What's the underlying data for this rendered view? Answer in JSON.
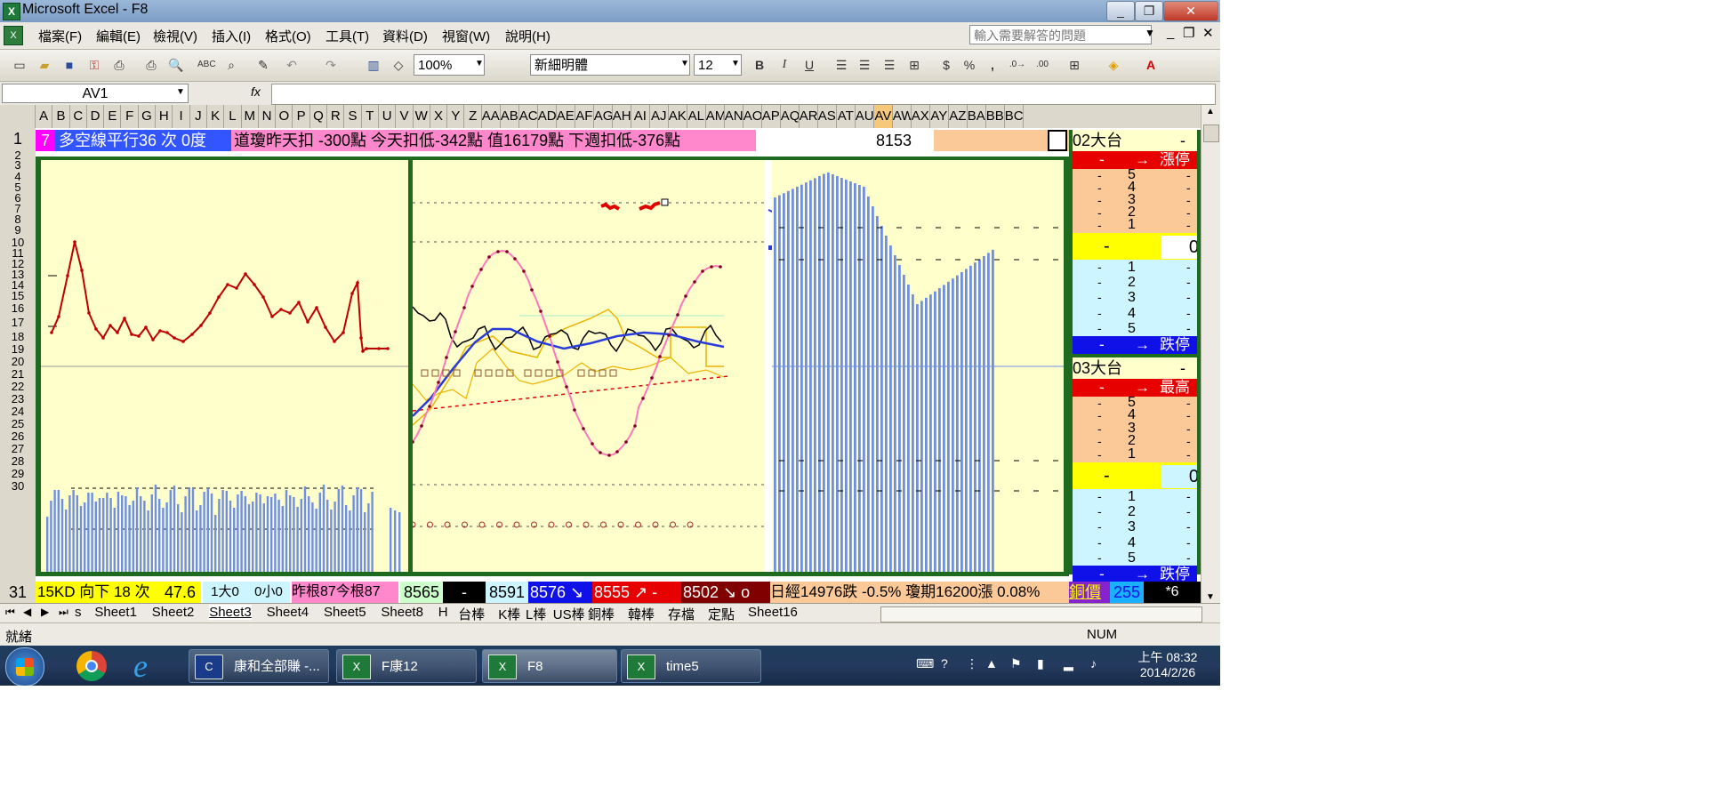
{
  "window": {
    "title": "Microsoft Excel - F8",
    "app_icon": "excel-icon"
  },
  "menu": {
    "items": [
      "檔案(F)",
      "編輯(E)",
      "檢視(V)",
      "插入(I)",
      "格式(O)",
      "工具(T)",
      "資料(D)",
      "視窗(W)",
      "說明(H)"
    ],
    "help_placeholder": "輸入需要解答的問題"
  },
  "toolbar": {
    "zoom": "100%",
    "font_name": "新細明體",
    "font_size": "12",
    "currency": "$",
    "percent": "%",
    "comma": ","
  },
  "formula_bar": {
    "name_box": "AV1",
    "fx": "fx",
    "content": ""
  },
  "columns": [
    "A",
    "B",
    "C",
    "D",
    "E",
    "F",
    "G",
    "H",
    "I",
    "J",
    "K",
    "L",
    "M",
    "N",
    "O",
    "P",
    "Q",
    "R",
    "S",
    "T",
    "U",
    "V",
    "W",
    "X",
    "Y",
    "Z",
    "AA",
    "AB",
    "AC",
    "AD",
    "AE",
    "AF",
    "AG",
    "AH",
    "AI",
    "AJ",
    "AK",
    "AL",
    "AM",
    "AN",
    "AO",
    "AP",
    "AQ",
    "AR",
    "AS",
    "AT",
    "AU",
    "AV",
    "AW",
    "AX",
    "AY",
    "AZ",
    "BA",
    "BB",
    "BC"
  ],
  "rows": [
    "1",
    "2",
    "3",
    "4",
    "5",
    "6",
    "7",
    "8",
    "9",
    "10",
    "11",
    "12",
    "13",
    "14",
    "15",
    "16",
    "17",
    "18",
    "19",
    "20",
    "21",
    "22",
    "23",
    "24",
    "25",
    "26",
    "27",
    "28",
    "29",
    "30",
    "31"
  ],
  "row1": {
    "num": "7",
    "ma_text": "多空線平行36 次 0度",
    "dow_text": "道瓊昨天扣 -300點 今天扣低-342點 值16179點 下週扣低-376點",
    "value": "8153"
  },
  "side_panel": {
    "title_02": "02大台",
    "limit_up": "漲停",
    "upper_levels": [
      "5",
      "4",
      "3",
      "2",
      "1"
    ],
    "value_02": "0",
    "lower_levels": [
      "1",
      "2",
      "3",
      "4",
      "5"
    ],
    "limit_down": "跌停",
    "title_03": "03大台",
    "high": "最高",
    "value_03": "0",
    "dash": "-",
    "arrow": "→"
  },
  "row31": {
    "kd": "15KD  向下 18 次",
    "kd_val": "47.6",
    "big": "1大0",
    "small": "0小0",
    "root": "昨根87今根87",
    "p1": "8565",
    "p2": "-",
    "p3": "8591",
    "p4": "8576",
    "p5": "8555",
    "p5b": "-",
    "p6": "8502",
    "p6b": "o",
    "market": "日經14976跌 -0.5%  瓊期16200漲 0.08%",
    "copper": "銅價",
    "copper_val": "255",
    "star": "*6"
  },
  "sheets": [
    "s",
    "Sheet1",
    "Sheet2",
    "Sheet3",
    "Sheet4",
    "Sheet5",
    "Sheet8",
    "H",
    "台棒",
    "K棒",
    "L棒",
    "US棒",
    "銅棒",
    "韓棒",
    "存檔",
    "定點",
    "Sheet16"
  ],
  "active_sheet": "Sheet3",
  "status": {
    "ready": "就緒",
    "num": "NUM"
  },
  "taskbar": {
    "items": [
      "康和全部賺 -...",
      "F康12",
      "F8",
      "time5"
    ],
    "time": "上午 08:32",
    "date": "2014/2/26"
  },
  "colors": {
    "chart_bg": "#ffffcc",
    "border_green": "#1e6a1e",
    "bars": "#6f8fe6",
    "red_line": "#c00000",
    "pink": "#ff77bb"
  }
}
